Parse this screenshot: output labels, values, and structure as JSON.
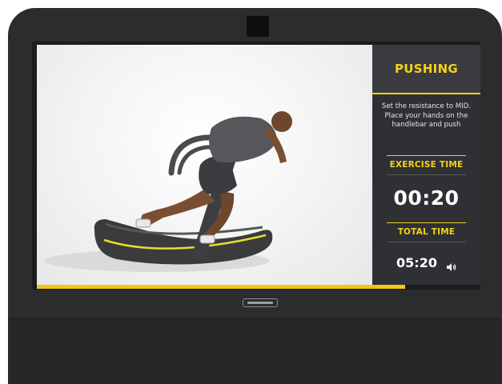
{
  "panel": {
    "phase_title": "PUSHING",
    "instruction": "Set the resistance to MID. Place your hands on the handlebar and push",
    "exercise_time_label": "EXERCISE TIME",
    "exercise_time": "00:20",
    "total_time_label": "TOTAL TIME",
    "total_time": "05:20"
  },
  "progress": {
    "fraction": 0.83
  },
  "icons": {
    "volume": "volume-icon",
    "brand_logo": "brand-logo"
  },
  "colors": {
    "accent": "#f2d21a",
    "panel_bg": "#2f3033",
    "frame": "#2b2c2e"
  }
}
